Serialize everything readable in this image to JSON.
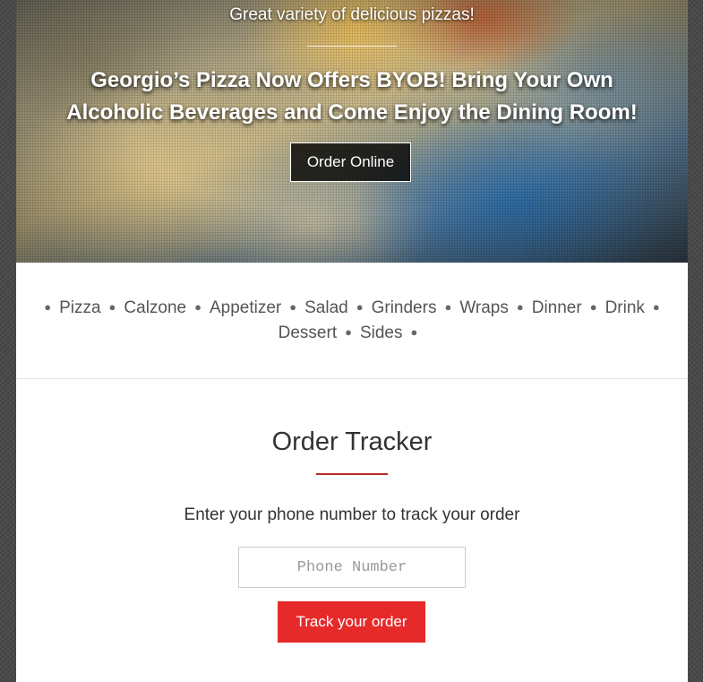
{
  "hero": {
    "tagline": "Great variety of delicious pizzas!",
    "headline_line1": "Georgio’s Pizza Now Offers BYOB! Bring Your Own",
    "headline_line2": "Alcoholic Beverages and Come Enjoy the Dining Room!",
    "order_online_label": "Order Online"
  },
  "menu": {
    "items": [
      "Pizza",
      "Calzone",
      "Appetizer",
      "Salad",
      "Grinders",
      "Wraps",
      "Dinner",
      "Drink",
      "Dessert",
      "Sides"
    ]
  },
  "tracker": {
    "title": "Order Tracker",
    "subtitle": "Enter your phone number to track your order",
    "phone_placeholder": "Phone Number",
    "phone_value": "",
    "track_button_label": "Track your order"
  },
  "colors": {
    "accent": "#e62a2a",
    "divider": "#b52a2a",
    "button_dark": "#000000"
  },
  "icons": {
    "menu_separator": "bullet-icon"
  }
}
